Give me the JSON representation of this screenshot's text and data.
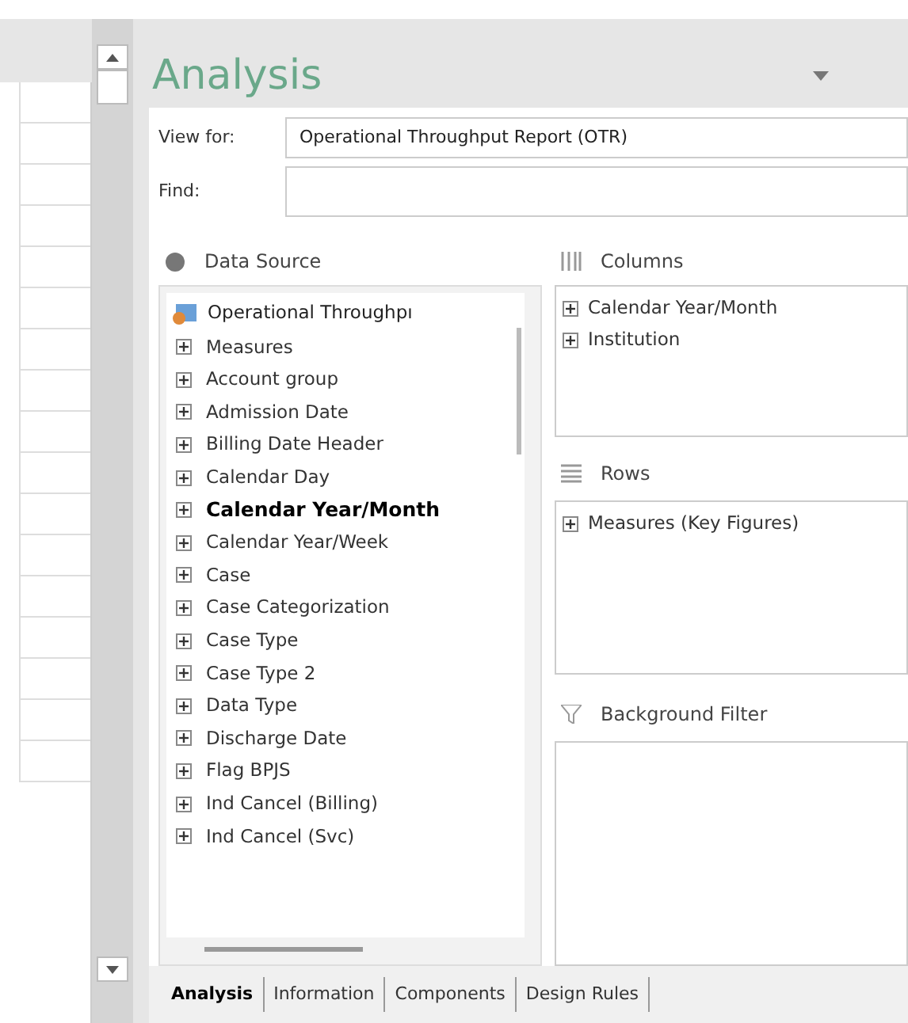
{
  "panel": {
    "title": "Analysis"
  },
  "view_for": {
    "label": "View for:",
    "value": "Operational Throughput Report (OTR)"
  },
  "find": {
    "label": "Find:"
  },
  "data_source": {
    "title": "Data Source",
    "root": "Operational Throughpı",
    "items": [
      {
        "label": "Measures",
        "expanded": false,
        "selected": false
      },
      {
        "label": "Account group",
        "expanded": false,
        "selected": false
      },
      {
        "label": "Admission Date",
        "expanded": false,
        "selected": false
      },
      {
        "label": "Billing Date Header",
        "expanded": false,
        "selected": false
      },
      {
        "label": "Calendar Day",
        "expanded": false,
        "selected": false
      },
      {
        "label": "Calendar Year/Month",
        "expanded": false,
        "selected": true
      },
      {
        "label": "Calendar Year/Week",
        "expanded": false,
        "selected": false
      },
      {
        "label": "Case",
        "expanded": false,
        "selected": false
      },
      {
        "label": "Case Categorization",
        "expanded": false,
        "selected": false
      },
      {
        "label": "Case Type",
        "expanded": false,
        "selected": false
      },
      {
        "label": "Case Type 2",
        "expanded": false,
        "selected": false
      },
      {
        "label": "Data Type",
        "expanded": false,
        "selected": false
      },
      {
        "label": "Discharge Date",
        "expanded": false,
        "selected": false
      },
      {
        "label": "Flag BPJS",
        "expanded": false,
        "selected": false
      },
      {
        "label": "Ind Cancel (Billing)",
        "expanded": false,
        "selected": false
      },
      {
        "label": "Ind Cancel (Svc)",
        "expanded": false,
        "selected": false
      }
    ]
  },
  "columns": {
    "title": "Columns",
    "items": [
      {
        "label": "Calendar Year/Month",
        "expanded": false
      },
      {
        "label": "Institution",
        "expanded": false
      }
    ]
  },
  "rows": {
    "title": "Rows",
    "items": [
      {
        "label": "Measures (Key Figures)",
        "expanded": false
      }
    ]
  },
  "background_filter": {
    "title": "Background Filter"
  },
  "tabs": [
    {
      "label": "Analysis",
      "selected": true
    },
    {
      "label": "Information",
      "selected": false
    },
    {
      "label": "Components",
      "selected": false
    },
    {
      "label": "Design Rules",
      "selected": false
    }
  ]
}
